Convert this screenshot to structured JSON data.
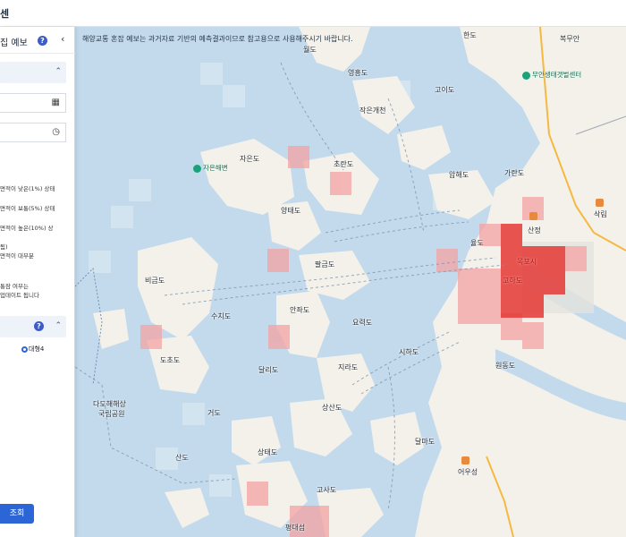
{
  "topbar": {
    "title": "센"
  },
  "panel": {
    "title": "집 예보",
    "help_label": "?",
    "collapse_label": "‹",
    "chevron_up": "⌃",
    "options": [
      "면적이 낮은(1%) 상태",
      "면적이 보통(5%) 상태",
      "면적이 높은(10%) 상",
      "됨)",
      "면적이 대부분",
      "",
      "통잠 여부는",
      "업데이트 됩니다"
    ],
    "section2_help": "?",
    "radio_label": "대형4",
    "search_button": "조회"
  },
  "map": {
    "notice": "해양교통 혼잡 예보는 과거자료 기반의 예측결과이므로 참고용으로 사용해주시기 바랍니다.",
    "places": [
      {
        "name": "월도"
      },
      {
        "name": "영흥도"
      },
      {
        "name": "고이도"
      },
      {
        "name": "작은개천"
      },
      {
        "name": "자은도"
      },
      {
        "name": "초란도"
      },
      {
        "name": "압해도"
      },
      {
        "name": "가란도"
      },
      {
        "name": "양태도"
      },
      {
        "name": "팔금도"
      },
      {
        "name": "산정"
      },
      {
        "name": "율도"
      },
      {
        "name": "목포시"
      },
      {
        "name": "고하도"
      },
      {
        "name": "비금도"
      },
      {
        "name": "수치도"
      },
      {
        "name": "안좌도"
      },
      {
        "name": "요력도"
      },
      {
        "name": "도초도"
      },
      {
        "name": "지라도"
      },
      {
        "name": "시하도"
      },
      {
        "name": "달리도"
      },
      {
        "name": "원동도"
      },
      {
        "name": "상산도"
      },
      {
        "name": "다도해해상"
      },
      {
        "name": "국립공원"
      },
      {
        "name": "거도"
      },
      {
        "name": "산도"
      },
      {
        "name": "상태도"
      },
      {
        "name": "달마도"
      },
      {
        "name": "고사도"
      },
      {
        "name": "어우성"
      },
      {
        "name": "평대섬"
      },
      {
        "name": "영흥도"
      },
      {
        "name": "한도"
      },
      {
        "name": "복무안"
      },
      {
        "name": "삭림"
      }
    ],
    "pois": [
      {
        "name": "무안생태갯벌센터"
      },
      {
        "name": "자은해변"
      }
    ]
  },
  "colors": {
    "sea": "#c3daec",
    "land": "#f3f1ea",
    "accent": "#2c66d6",
    "congestion_high": "#e53935",
    "congestion_mid": "#f4a3a3"
  }
}
